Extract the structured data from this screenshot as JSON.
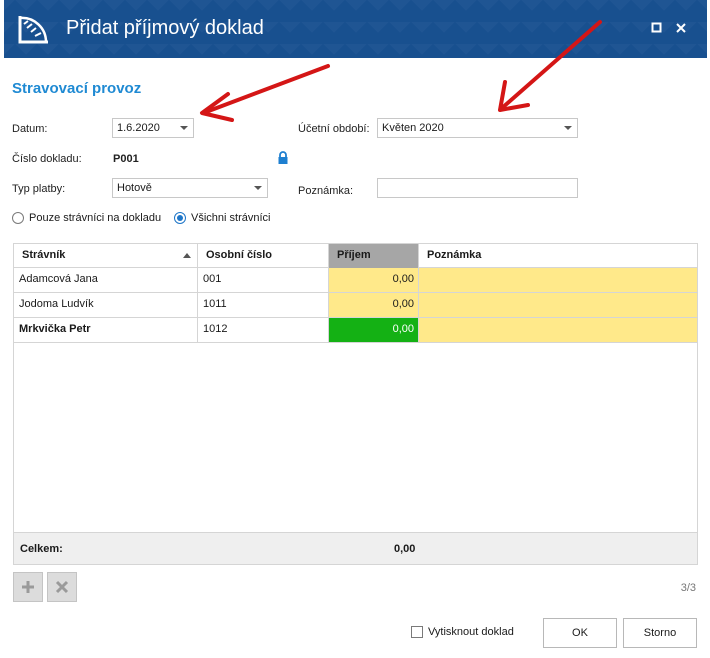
{
  "window": {
    "title": "Přidat příjmový doklad"
  },
  "section_title": "Stravovací provoz",
  "form": {
    "datum_label": "Datum:",
    "datum_value": "1.6.2020",
    "obdobi_label": "Účetní období:",
    "obdobi_value": "Květen 2020",
    "cislo_label": "Číslo dokladu:",
    "cislo_value": "P001",
    "typ_label": "Typ platby:",
    "typ_value": "Hotově",
    "poznamka_label": "Poznámka:",
    "poznamka_value": ""
  },
  "radios": [
    {
      "label": "Pouze strávníci na dokladu",
      "selected": false
    },
    {
      "label": "Všichni strávníci",
      "selected": true
    }
  ],
  "grid": {
    "columns": [
      "Strávník",
      "Osobní číslo",
      "Příjem",
      "Poznámka"
    ],
    "rows": [
      {
        "stravnik": "Adamcová Jana",
        "cislo": "001",
        "prijem": "0,00",
        "poznamka": ""
      },
      {
        "stravnik": "Jodoma Ludvík",
        "cislo": "1011",
        "prijem": "0,00",
        "poznamka": ""
      },
      {
        "stravnik": "Mrkvička Petr",
        "cislo": "1012",
        "prijem": "0,00",
        "poznamka": ""
      }
    ],
    "footer_label": "Celkem:",
    "footer_total": "0,00"
  },
  "pager": "3/3",
  "print_checkbox_label": "Vytisknout doklad",
  "buttons": {
    "ok": "OK",
    "cancel": "Storno"
  },
  "colors": {
    "titlebar": "#18508f",
    "accent": "#1f8ad3",
    "editable_cell": "#ffe98a",
    "active_cell": "#14b114",
    "annotation_arrow": "#d41616"
  }
}
